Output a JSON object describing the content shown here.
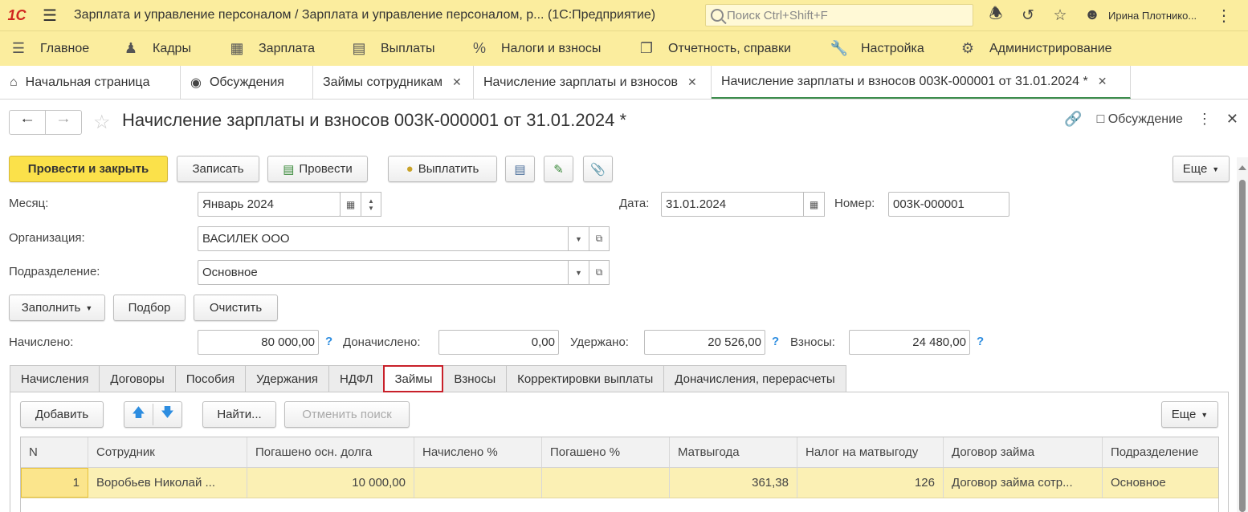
{
  "titlebar": {
    "logo": "1С",
    "title": "Зарплата и управление персоналом / Зарплата и управление персоналом, р...   (1С:Предприятие)",
    "search_placeholder": "Поиск Ctrl+Shift+F",
    "user": "Ирина Плотнико..."
  },
  "mainmenu": [
    {
      "label": "Главное",
      "icon": "menu-icon"
    },
    {
      "label": "Кадры",
      "icon": "people-icon"
    },
    {
      "label": "Зарплата",
      "icon": "calculator-icon"
    },
    {
      "label": "Выплаты",
      "icon": "wallet-icon"
    },
    {
      "label": "Налоги и взносы",
      "icon": "percent-icon"
    },
    {
      "label": "Отчетность, справки",
      "icon": "documents-icon"
    },
    {
      "label": "Настройка",
      "icon": "wrench-icon"
    },
    {
      "label": "Администрирование",
      "icon": "gear-icon"
    }
  ],
  "wintabs": [
    {
      "label": "Начальная страница"
    },
    {
      "label": "Обсуждения"
    },
    {
      "label": "Займы сотрудникам"
    },
    {
      "label": "Начисление зарплаты и взносов"
    },
    {
      "label": "Начисление зарплаты и взносов 003К-000001 от 31.01.2024 *"
    }
  ],
  "form": {
    "title": "Начисление зарплаты и взносов 003К-000001 от 31.01.2024 *",
    "discussion_label": "Обсуждение"
  },
  "toolbar": {
    "post_close": "Провести и закрыть",
    "save": "Записать",
    "post": "Провести",
    "pay": "Выплатить",
    "more": "Еще"
  },
  "fields": {
    "month_label": "Месяц:",
    "month_value": "Январь 2024",
    "date_label": "Дата:",
    "date_value": "31.01.2024",
    "number_label": "Номер:",
    "number_value": "003К-000001",
    "org_label": "Организация:",
    "org_value": "ВАСИЛЕК ООО",
    "dept_label": "Подразделение:",
    "dept_value": "Основное"
  },
  "actions": {
    "fill": "Заполнить",
    "select": "Подбор",
    "clear": "Очистить"
  },
  "totals": {
    "accrued_label": "Начислено:",
    "accrued_value": "80 000,00",
    "extra_label": "Доначислено:",
    "extra_value": "0,00",
    "withheld_label": "Удержано:",
    "withheld_value": "20 526,00",
    "contrib_label": "Взносы:",
    "contrib_value": "24 480,00",
    "help": "?"
  },
  "pagetabs": [
    {
      "label": "Начисления"
    },
    {
      "label": "Договоры"
    },
    {
      "label": "Пособия"
    },
    {
      "label": "Удержания"
    },
    {
      "label": "НДФЛ"
    },
    {
      "label": "Займы"
    },
    {
      "label": "Взносы"
    },
    {
      "label": "Корректировки выплаты"
    },
    {
      "label": "Доначисления, перерасчеты"
    }
  ],
  "panel_toolbar": {
    "add": "Добавить",
    "find": "Найти...",
    "cancel_search": "Отменить поиск",
    "more": "Еще"
  },
  "table": {
    "columns": [
      "N",
      "Сотрудник",
      "Погашено осн. долга",
      "Начислено %",
      "Погашено %",
      "Матвыгода",
      "Налог на матвыгоду",
      "Договор займа",
      "Подразделение"
    ],
    "rows": [
      [
        "1",
        "Воробьев Николай ...",
        "10 000,00",
        "",
        "",
        "361,38",
        "126",
        "Договор займа сотр...",
        "Основное"
      ]
    ]
  }
}
